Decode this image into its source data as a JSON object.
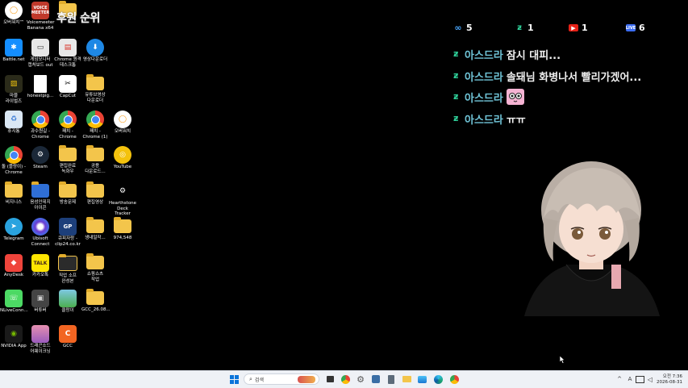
{
  "overlay": {
    "rank_title": "후원 순위",
    "stats": [
      {
        "icon": "infinity-icon",
        "value": "5",
        "color": "#4aa8ff"
      },
      {
        "icon": "chzzk-icon",
        "value": "1",
        "color": "#2fd19a"
      },
      {
        "icon": "youtube-icon",
        "value": "1",
        "color": "#e62117"
      },
      {
        "icon": "live-icon",
        "value": "6",
        "color": "#3b6cf2"
      }
    ],
    "chat": [
      {
        "name": "아스드라",
        "message": "잠시 대피..."
      },
      {
        "name": "아스드라",
        "message": "솔돼님 화병나서 빨리가겠어..."
      },
      {
        "name": "아스드라",
        "message": "",
        "emote": "pink-emote-icon"
      },
      {
        "name": "아스드라",
        "message": "ㅠㅠ"
      }
    ]
  },
  "desktop": {
    "icons": [
      {
        "label": "오버워치™",
        "icon": "overwatch-icon"
      },
      {
        "label": "Voicemeeter\nBanana x64",
        "icon": "voicemeeter-icon"
      },
      {
        "label": "",
        "icon": "folder-icon"
      },
      {
        "label": "Battle.net",
        "icon": "battlenet-icon"
      },
      {
        "label": "게임모니터\n캡처보드 out",
        "icon": "monitor-icon"
      },
      {
        "label": "Chrome 원격\n데스크톱",
        "icon": "chrome-remote-icon"
      },
      {
        "label": "영상다운로더",
        "icon": "downloader-icon"
      },
      {
        "label": "마블\n라이벌즈",
        "icon": "marvel-rivals-icon"
      },
      {
        "label": "honestpig...",
        "icon": "file-icon"
      },
      {
        "label": "CapCut",
        "icon": "capcut-icon"
      },
      {
        "label": "유튜브영상\n다운로더",
        "icon": "folder-icon"
      },
      {
        "label": "휴지통",
        "icon": "recycle-bin-icon"
      },
      {
        "label": "과수원길 -\nChrome",
        "icon": "chrome-icon"
      },
      {
        "label": "패치 -\nChrome",
        "icon": "chrome-icon"
      },
      {
        "label": "패치 -\nChrome (1)",
        "icon": "chrome-icon"
      },
      {
        "label": "오버워치",
        "icon": "overwatch-icon"
      },
      {
        "label": "돌 (플랑이) -\nChrome",
        "icon": "chrome-icon"
      },
      {
        "label": "Steam",
        "icon": "steam-icon"
      },
      {
        "label": "편집완료\n녹화우",
        "icon": "folder-icon"
      },
      {
        "label": "공용\n다운로드...",
        "icon": "folder-icon"
      },
      {
        "label": "YouTube",
        "icon": "youtube-desktop-icon"
      },
      {
        "label": "비지니스",
        "icon": "folder-icon"
      },
      {
        "label": "음성인데지\n아이콘",
        "icon": "folder-icon"
      },
      {
        "label": "방송문제",
        "icon": "folder-icon"
      },
      {
        "label": "편집영상",
        "icon": "folder-icon"
      },
      {
        "label": "Hearthstone\nDeck Tracker",
        "icon": "hearthstone-icon"
      },
      {
        "label": "Telegram",
        "icon": "telegram-icon"
      },
      {
        "label": "Ubisoft\nConnect",
        "icon": "ubisoft-icon"
      },
      {
        "label": "큐피자랑 -\nclip24.co.kr",
        "icon": "gpu-icon"
      },
      {
        "label": "생내일작...",
        "icon": "folder-icon"
      },
      {
        "label": "974,548",
        "icon": "folder-icon"
      },
      {
        "label": "AnyDesk",
        "icon": "anydesk-icon"
      },
      {
        "label": "카카오톡",
        "icon": "kakaotalk-icon"
      },
      {
        "label": "직업 소프\n완성본",
        "icon": "folder-icon"
      },
      {
        "label": "쇼핑쇼츠\n작업",
        "icon": "folder-icon"
      },
      {
        "label": "NLiveConn...",
        "icon": "nlive-icon"
      },
      {
        "label": "버튜버",
        "icon": "vtuber-icon"
      },
      {
        "label": "클랑이",
        "icon": "image-icon"
      },
      {
        "label": "GCC_26.08...",
        "icon": "folder-icon"
      },
      {
        "label": "NVIDIA App",
        "icon": "nvidia-icon"
      },
      {
        "label": "드래곤소드\n어웨이크닝",
        "icon": "dragonsword-icon"
      },
      {
        "label": "GCC",
        "icon": "gcc-icon"
      }
    ]
  },
  "taskbar": {
    "search_placeholder": "검색",
    "apps": [
      "start-icon",
      "search-icon",
      "task-view-icon",
      "chrome-icon",
      "settings-icon",
      "app-icon",
      "calculator-icon",
      "explorer-icon",
      "photos-icon",
      "edge-icon",
      "chrome-alt-icon"
    ],
    "time": "오전 7:36",
    "date": "2026-08-31",
    "tray": [
      "chevron-up-icon",
      "keyboard-ime-icon",
      "network-icon",
      "volume-icon"
    ]
  }
}
